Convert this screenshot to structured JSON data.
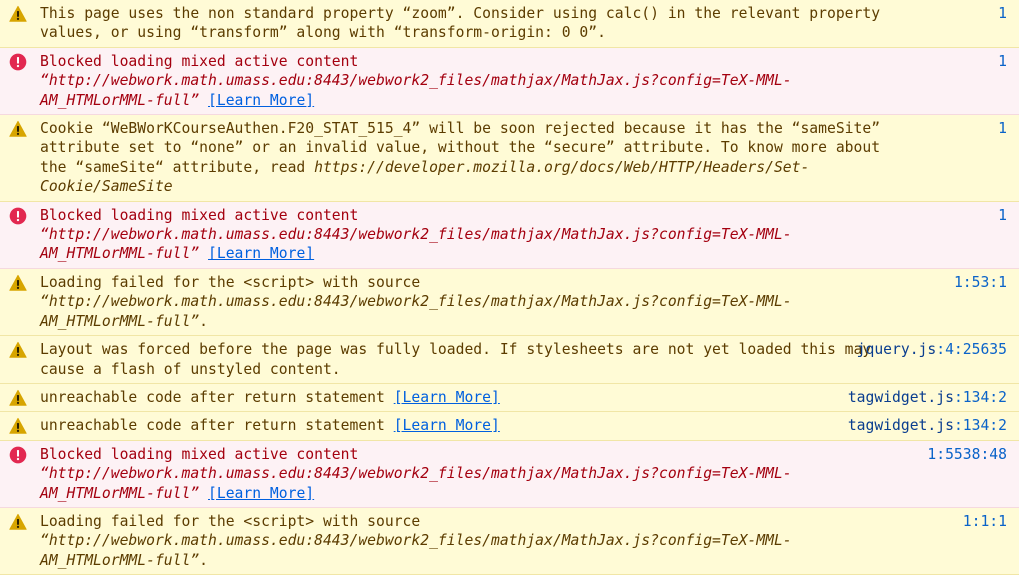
{
  "console": {
    "learn_more_label": "[Learn More]",
    "messages": [
      {
        "level": "warn",
        "icon": "warning-icon",
        "parts": [
          {
            "t": "text",
            "v": "This page uses the non standard property “zoom”. Consider using calc() in the relevant property values, or using “transform” along with “transform-origin: 0 0”."
          }
        ],
        "location_file": "",
        "location_pos": "1"
      },
      {
        "level": "error",
        "icon": "error-icon",
        "parts": [
          {
            "t": "text",
            "v": "Blocked loading mixed active content "
          },
          {
            "t": "url",
            "v": "“http://webwork.math.umass.edu:8443/webwork2_files/mathjax/MathJax.js?config=TeX-MML-AM_HTMLorMML-full”"
          },
          {
            "t": "text",
            "v": " "
          },
          {
            "t": "learn",
            "v": "[Learn More]"
          }
        ],
        "location_file": "",
        "location_pos": "1"
      },
      {
        "level": "warn",
        "icon": "warning-icon",
        "parts": [
          {
            "t": "text",
            "v": "Cookie “WeBWorKCourseAuthen.F20_STAT_515_4” will be soon rejected because it has the “sameSite” attribute set to “none” or an invalid value, without the “secure” attribute. To know more about the “sameSite“ attribute, read "
          },
          {
            "t": "url",
            "v": "https://developer.mozilla.org/docs/Web/HTTP/Headers/Set-Cookie/SameSite"
          }
        ],
        "location_file": "",
        "location_pos": "1"
      },
      {
        "level": "error",
        "icon": "error-icon",
        "parts": [
          {
            "t": "text",
            "v": "Blocked loading mixed active content "
          },
          {
            "t": "url",
            "v": "“http://webwork.math.umass.edu:8443/webwork2_files/mathjax/MathJax.js?config=TeX-MML-AM_HTMLorMML-full”"
          },
          {
            "t": "text",
            "v": " "
          },
          {
            "t": "learn",
            "v": "[Learn More]"
          }
        ],
        "location_file": "",
        "location_pos": "1"
      },
      {
        "level": "warn",
        "icon": "warning-icon",
        "parts": [
          {
            "t": "text",
            "v": "Loading failed for the <script> with source "
          },
          {
            "t": "url",
            "v": "“http://webwork.math.umass.edu:8443/webwork2_files/mathjax/MathJax.js?config=TeX-MML-AM_HTMLorMML-full”"
          },
          {
            "t": "text",
            "v": "."
          }
        ],
        "location_file": "",
        "location_pos": "1:53:1"
      },
      {
        "level": "warn",
        "icon": "warning-icon",
        "parts": [
          {
            "t": "text",
            "v": "Layout was forced before the page was fully loaded. If stylesheets are not yet loaded this may cause a flash of unstyled content."
          }
        ],
        "location_file": "jquery.js",
        "location_pos": ":4:25635"
      },
      {
        "level": "warn",
        "icon": "warning-icon",
        "parts": [
          {
            "t": "text",
            "v": "unreachable code after return statement "
          },
          {
            "t": "learn",
            "v": "[Learn More]"
          }
        ],
        "location_file": "tagwidget.js",
        "location_pos": ":134:2"
      },
      {
        "level": "warn",
        "icon": "warning-icon",
        "parts": [
          {
            "t": "text",
            "v": "unreachable code after return statement "
          },
          {
            "t": "learn",
            "v": "[Learn More]"
          }
        ],
        "location_file": "tagwidget.js",
        "location_pos": ":134:2"
      },
      {
        "level": "error",
        "icon": "error-icon",
        "parts": [
          {
            "t": "text",
            "v": "Blocked loading mixed active content "
          },
          {
            "t": "url",
            "v": "“http://webwork.math.umass.edu:8443/webwork2_files/mathjax/MathJax.js?config=TeX-MML-AM_HTMLorMML-full”"
          },
          {
            "t": "text",
            "v": " "
          },
          {
            "t": "learn",
            "v": "[Learn More]"
          }
        ],
        "location_file": "",
        "location_pos": "1:5538:48"
      },
      {
        "level": "warn",
        "icon": "warning-icon",
        "parts": [
          {
            "t": "text",
            "v": "Loading failed for the <script> with source "
          },
          {
            "t": "url",
            "v": "“http://webwork.math.umass.edu:8443/webwork2_files/mathjax/MathJax.js?config=TeX-MML-AM_HTMLorMML-full”"
          },
          {
            "t": "text",
            "v": "."
          }
        ],
        "location_file": "",
        "location_pos": "1:1:1"
      }
    ]
  },
  "colors": {
    "warn_bg": "#fffbd6",
    "warn_text": "#5c3c00",
    "error_bg": "#fdf2f5",
    "error_text": "#a4000f",
    "link": "#0060df"
  }
}
